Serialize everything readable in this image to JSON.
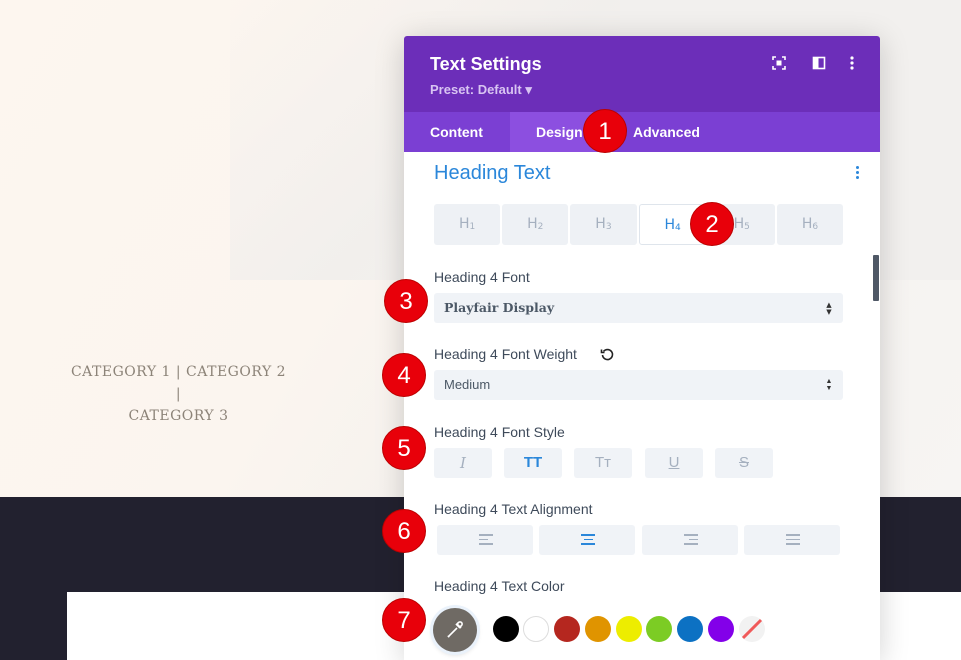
{
  "page": {
    "categories_line1": "CATEGORY 1 | CATEGORY 2 |",
    "categories_line2": "CATEGORY 3"
  },
  "modal": {
    "title": "Text Settings",
    "preset": "Preset: Default ▾",
    "header_icons": [
      "expand-icon",
      "sidebar-layout-icon",
      "more-vertical-icon"
    ],
    "tabs": [
      {
        "label": "Content",
        "active": false
      },
      {
        "label": "Design",
        "active": true
      },
      {
        "label": "Advanced",
        "active": false
      }
    ],
    "section_title": "Heading Text",
    "heading_tabs": [
      {
        "label": "H",
        "sub": "1",
        "active": false
      },
      {
        "label": "H",
        "sub": "2",
        "active": false
      },
      {
        "label": "H",
        "sub": "3",
        "active": false
      },
      {
        "label": "H",
        "sub": "4",
        "active": true
      },
      {
        "label": "H",
        "sub": "5",
        "active": false
      },
      {
        "label": "H",
        "sub": "6",
        "active": false
      }
    ],
    "font_label": "Heading 4 Font",
    "font_value": "Playfair Display",
    "weight_label": "Heading 4 Font Weight",
    "weight_value": "Medium",
    "style_label": "Heading 4 Font Style",
    "style_buttons": [
      {
        "glyph": "I",
        "name": "italic",
        "active": false
      },
      {
        "glyph": "TT",
        "name": "uppercase",
        "active": true
      },
      {
        "glyph": "Tт",
        "name": "capitalize",
        "active": false
      },
      {
        "glyph": "U",
        "name": "underline",
        "active": false
      },
      {
        "glyph": "S",
        "name": "strikethrough",
        "active": false
      }
    ],
    "alignment_label": "Heading 4 Text Alignment",
    "alignments": [
      {
        "name": "left",
        "active": false
      },
      {
        "name": "center",
        "active": true
      },
      {
        "name": "right",
        "active": false
      },
      {
        "name": "justify",
        "active": false
      }
    ],
    "color_label": "Heading 4 Text Color",
    "colors": [
      "#000000",
      "#ffffff",
      "#b5271f",
      "#e09400",
      "#eded00",
      "#7ccc24",
      "#0c71c3",
      "#8300e9",
      "transparent"
    ]
  },
  "callouts": [
    "1",
    "2",
    "3",
    "4",
    "5",
    "6",
    "7"
  ],
  "colors": {
    "header": "#6c2eb9",
    "tabbar": "#7b3fd3",
    "accent": "#2b87da",
    "badge": "#e8000a"
  }
}
